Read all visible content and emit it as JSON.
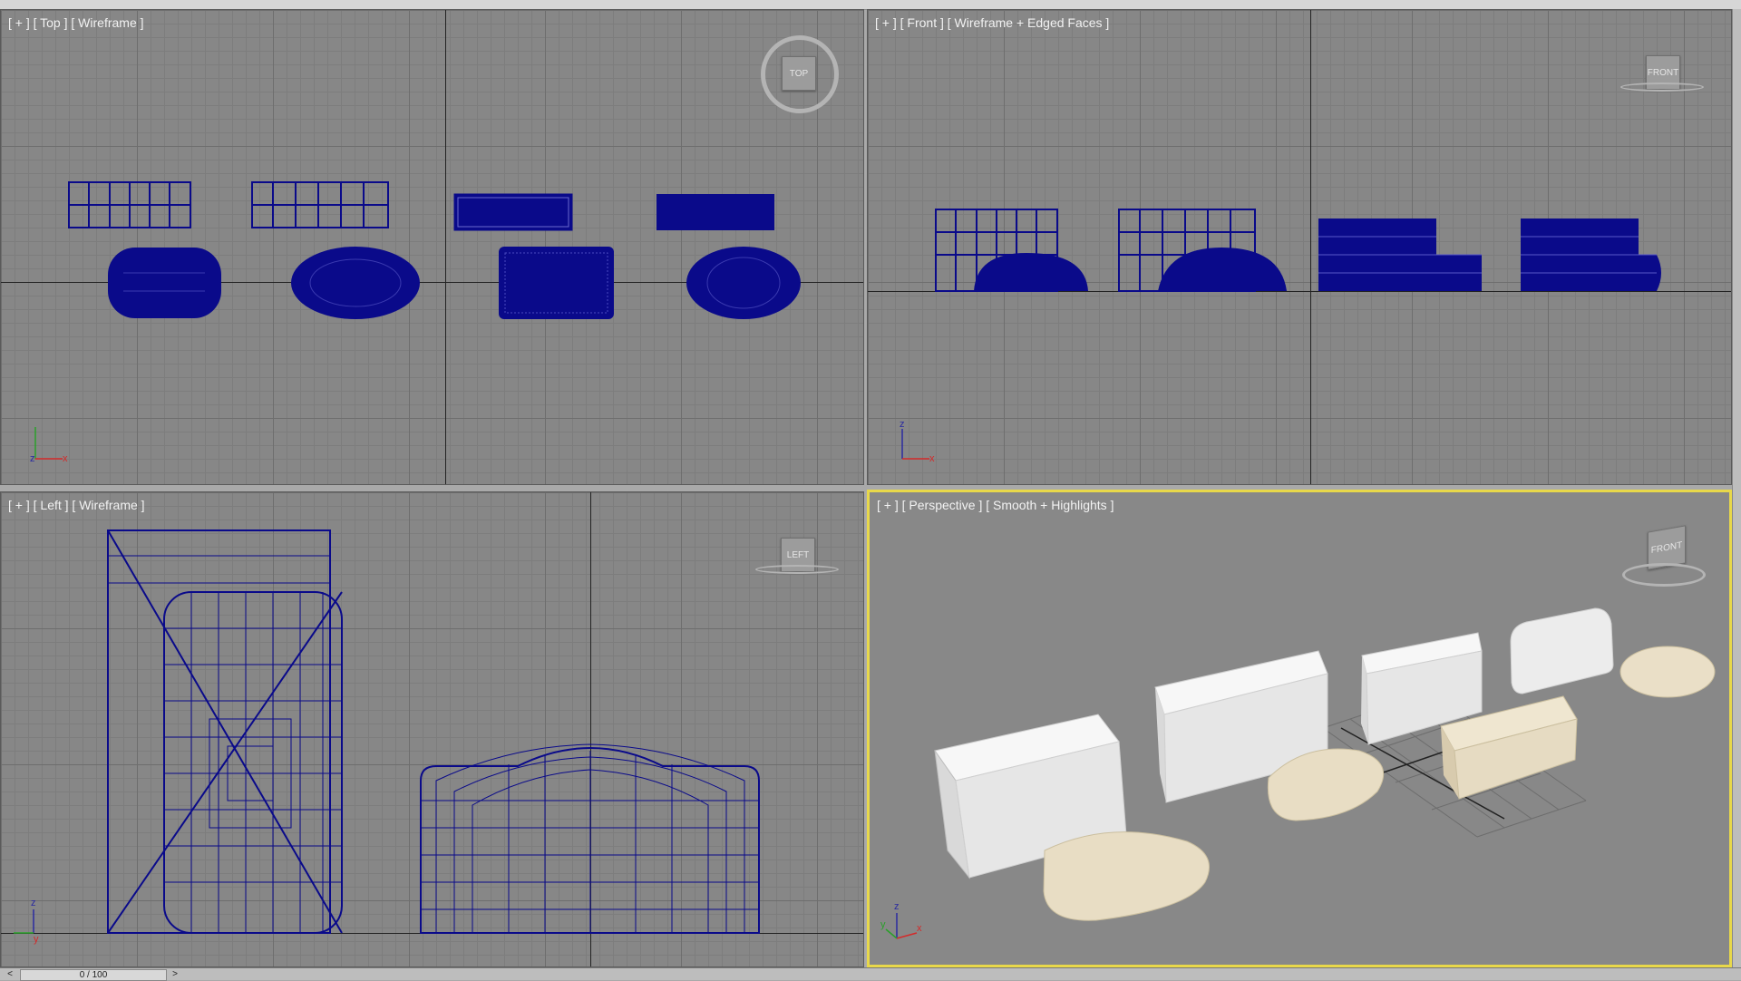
{
  "viewports": {
    "top": {
      "label": "[ + ] [ Top ] [ Wireframe ]",
      "nav_label": "TOP"
    },
    "front": {
      "label": "[ + ] [ Front ] [ Wireframe + Edged Faces ]",
      "nav_label": "FRONT"
    },
    "left": {
      "label": "[ + ] [ Left ] [ Wireframe ]",
      "nav_label": "LEFT"
    },
    "perspective": {
      "label": "[ + ] [ Perspective ] [ Smooth + Highlights ]",
      "nav_label": "FRONT",
      "active": true
    }
  },
  "axes": {
    "x": "x",
    "y": "y",
    "z": "z"
  },
  "timeline": {
    "frame_display": "0 / 100",
    "prev": "<",
    "next": ">"
  },
  "colors": {
    "wire": "#0a0a8a",
    "active_border": "#e8d84a",
    "box_white": "#e6e6e6",
    "soap": "#eae0c9"
  }
}
